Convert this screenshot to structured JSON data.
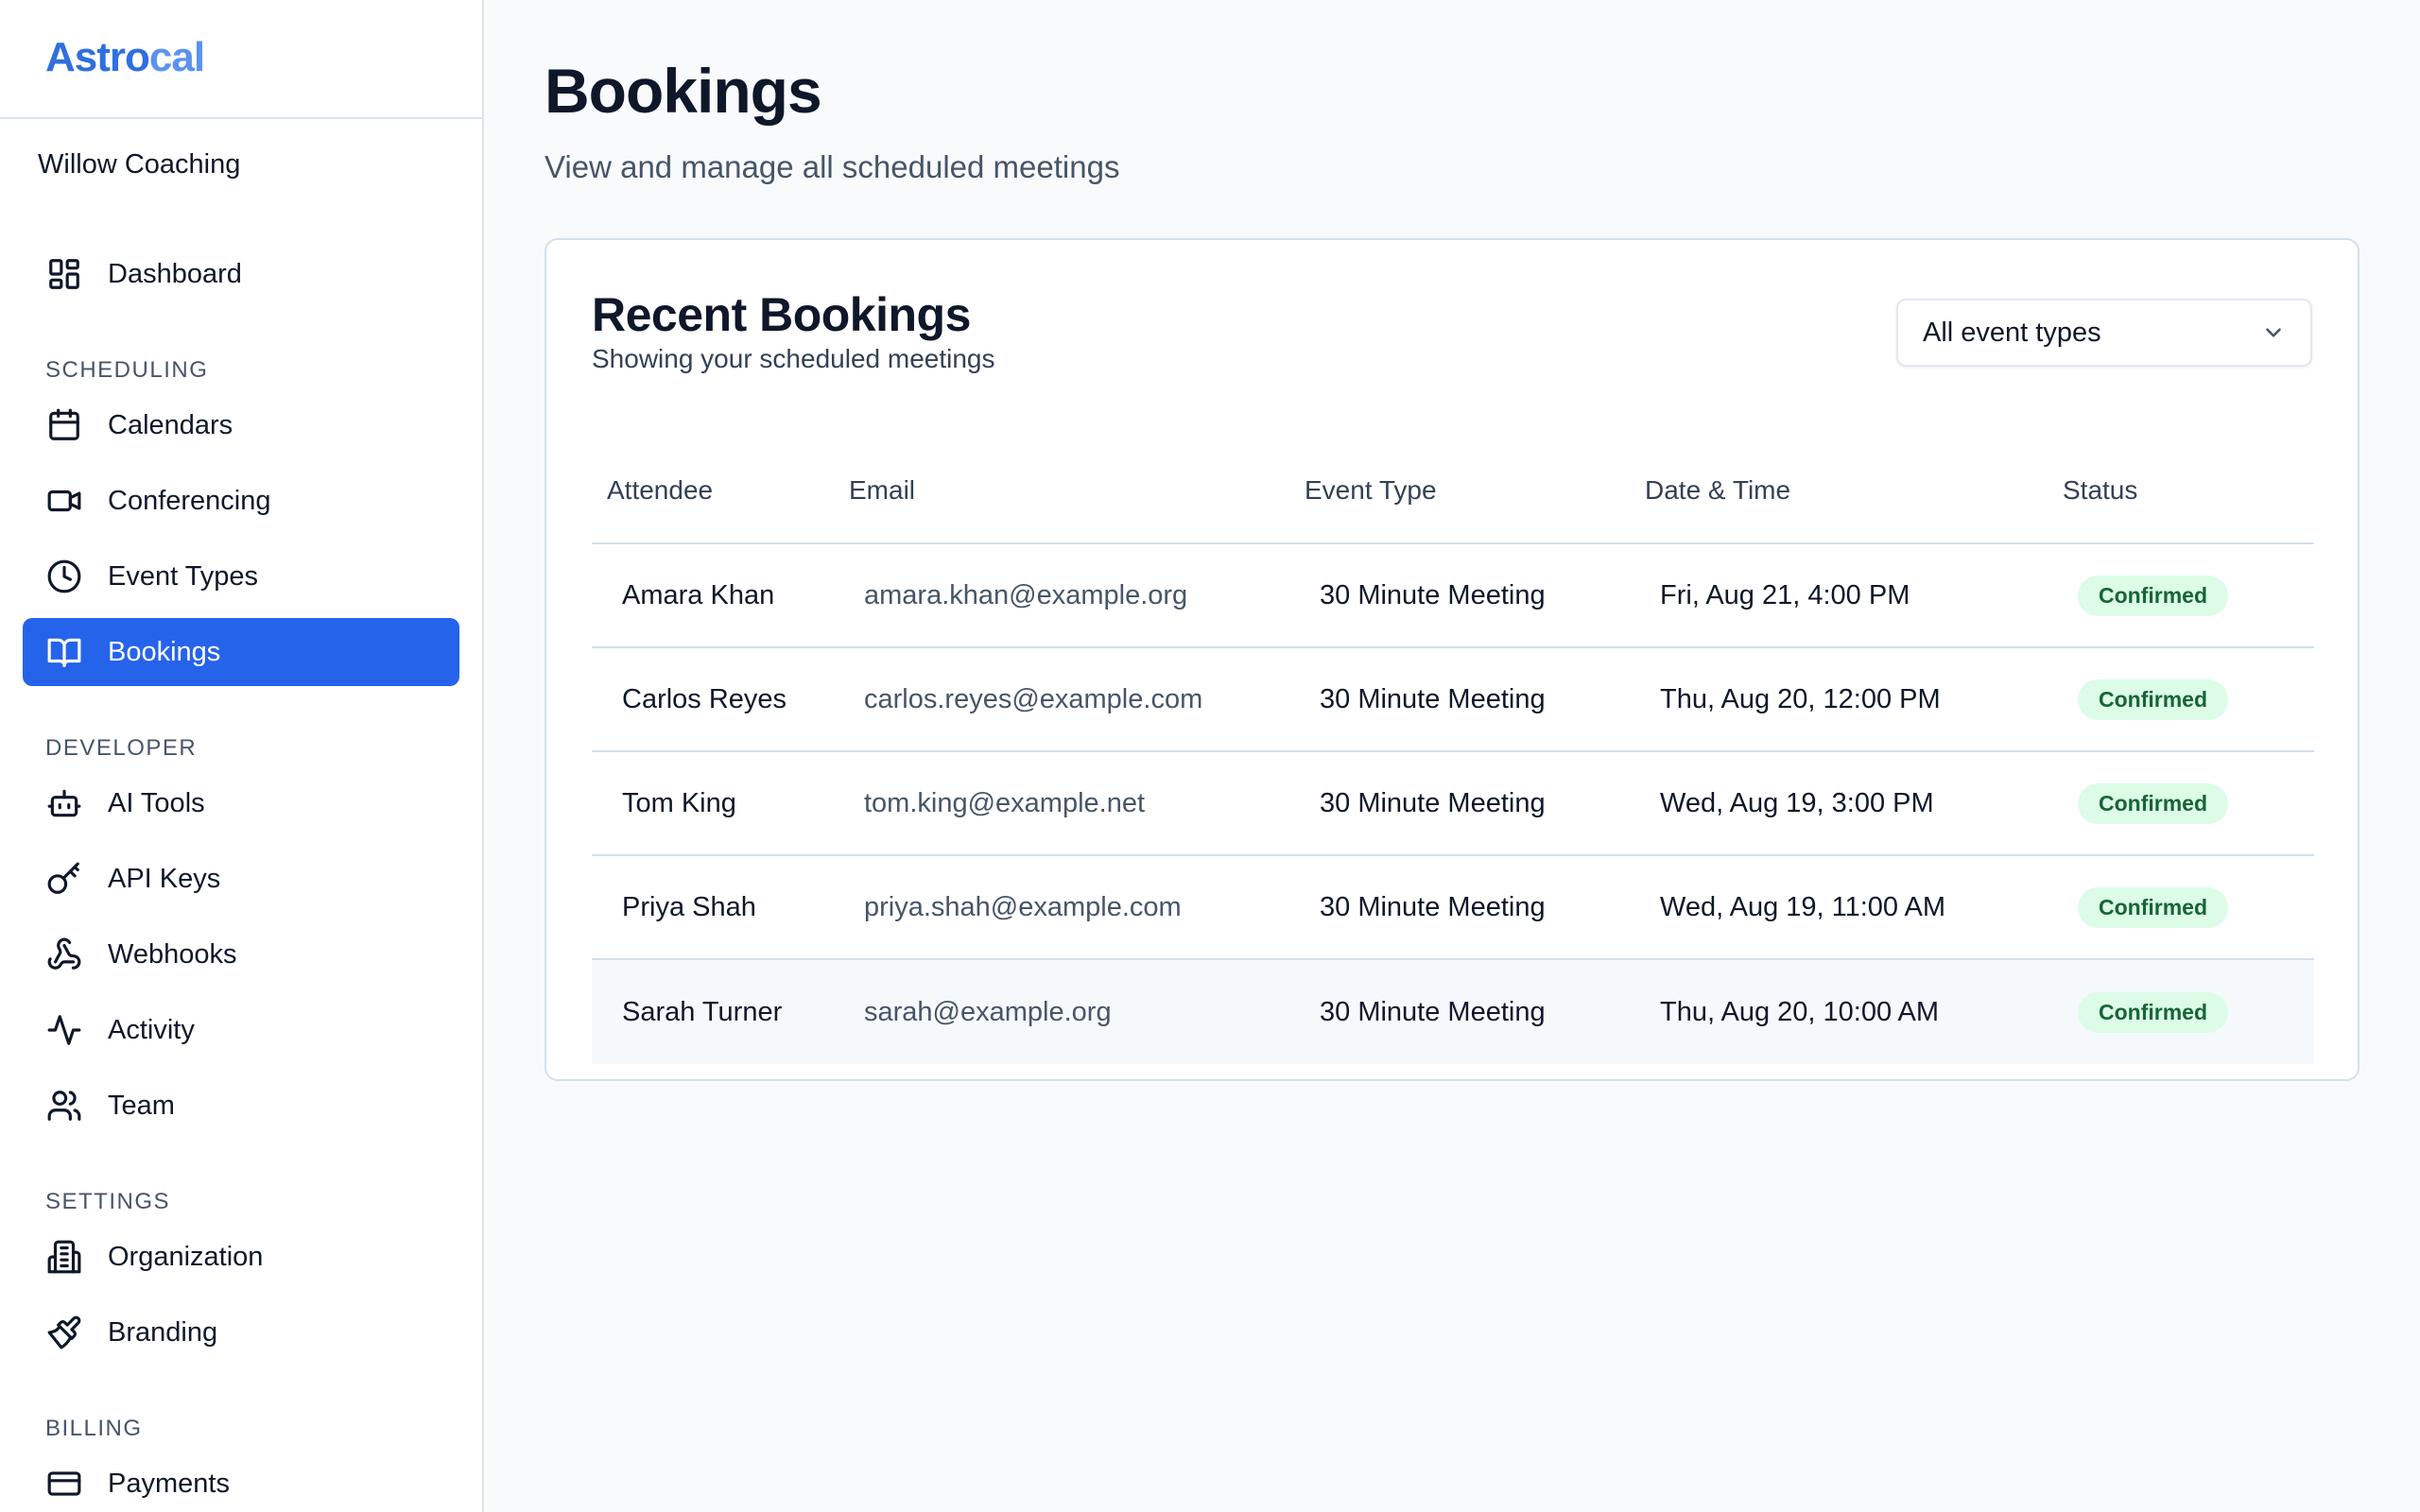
{
  "app": {
    "logo": "Astrocal",
    "logo_main": "Astro",
    "logo_tail": "cal"
  },
  "sidebar": {
    "org_name": "Willow Coaching",
    "items": [
      {
        "label": "Dashboard",
        "icon": "dashboard-icon"
      },
      {
        "label": "Calendars",
        "icon": "calendar-icon"
      },
      {
        "label": "Conferencing",
        "icon": "video-icon"
      },
      {
        "label": "Event Types",
        "icon": "clock-icon"
      },
      {
        "label": "Bookings",
        "icon": "book-icon",
        "active": true
      },
      {
        "label": "AI Tools",
        "icon": "bot-icon"
      },
      {
        "label": "API Keys",
        "icon": "key-icon"
      },
      {
        "label": "Webhooks",
        "icon": "webhook-icon"
      },
      {
        "label": "Activity",
        "icon": "activity-icon"
      },
      {
        "label": "Team",
        "icon": "users-icon"
      },
      {
        "label": "Organization",
        "icon": "building-icon"
      },
      {
        "label": "Branding",
        "icon": "paintbrush-icon"
      },
      {
        "label": "Payments",
        "icon": "credit-card-icon"
      }
    ],
    "sections": {
      "scheduling": "SCHEDULING",
      "developer": "DEVELOPER",
      "settings": "SETTINGS",
      "billing": "BILLING"
    }
  },
  "main": {
    "title": "Bookings",
    "subtitle": "View and manage all scheduled meetings",
    "card": {
      "title": "Recent Bookings",
      "subtitle": "Showing your scheduled meetings",
      "filter": {
        "selected": "All event types"
      },
      "columns": [
        "Attendee",
        "Email",
        "Event Type",
        "Date & Time",
        "Status"
      ],
      "rows": [
        {
          "attendee": "Amara Khan",
          "email": "amara.khan@example.org",
          "event": "30 Minute Meeting",
          "date": "Fri, Aug 21, 4:00 PM",
          "status": "Confirmed"
        },
        {
          "attendee": "Carlos Reyes",
          "email": "carlos.reyes@example.com",
          "event": "30 Minute Meeting",
          "date": "Thu, Aug 20, 12:00 PM",
          "status": "Confirmed"
        },
        {
          "attendee": "Tom King",
          "email": "tom.king@example.net",
          "event": "30 Minute Meeting",
          "date": "Wed, Aug 19, 3:00 PM",
          "status": "Confirmed"
        },
        {
          "attendee": "Priya Shah",
          "email": "priya.shah@example.com",
          "event": "30 Minute Meeting",
          "date": "Wed, Aug 19, 11:00 AM",
          "status": "Confirmed"
        },
        {
          "attendee": "Sarah Turner",
          "email": "sarah@example.org",
          "event": "30 Minute Meeting",
          "date": "Thu, Aug 20, 10:00 AM",
          "status": "Confirmed"
        }
      ]
    }
  },
  "colors": {
    "accent": "#2563eb",
    "logo": "#2f6fe0",
    "badge_bg": "#dcfce7",
    "badge_text": "#166534"
  }
}
